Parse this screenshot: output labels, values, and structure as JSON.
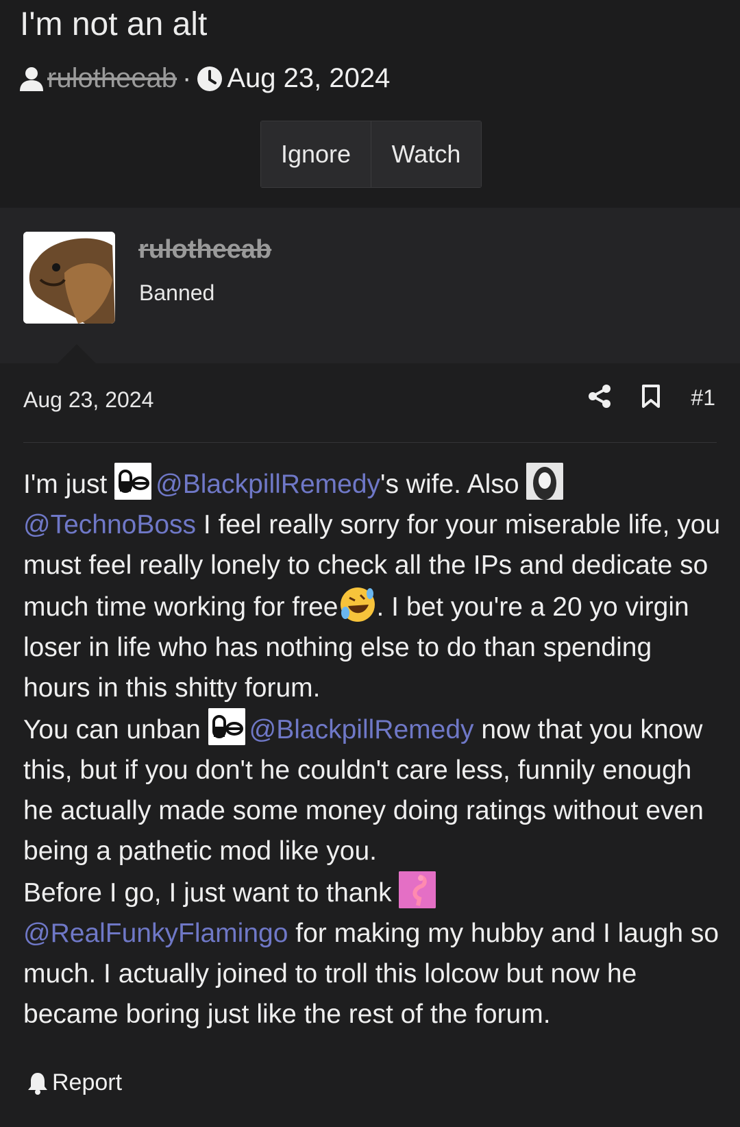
{
  "thread": {
    "title": "I'm not an alt",
    "author": "rulotheeab",
    "date": "Aug 23, 2024"
  },
  "buttons": {
    "ignore": "Ignore",
    "watch": "Watch"
  },
  "user": {
    "name": "rulotheeab",
    "title": "Banned"
  },
  "post": {
    "date": "Aug 23, 2024",
    "number": "#1",
    "body": {
      "t1": "I'm just ",
      "m1": "@BlackpillRemedy",
      "t2": "'s wife. Also ",
      "m2": "@TechnoBoss",
      "t3": " I feel really sorry for your miserable life, you must feel really lonely to check all the IPs and dedicate so much time working for free",
      "t4": ". I bet you're a 20 yo virgin loser in life who has nothing else to do than spending hours in this shitty forum.",
      "t5": "You can unban ",
      "m3": "@BlackpillRemedy",
      "t6": " now that you know this, but if you don't he couldn't care less, funnily enough he actually made some money doing ratings without even being a pathetic mod like you.",
      "t7": "Before I go, I just want to thank ",
      "m4": "@RealFunkyFlamingo",
      "t8": " for making my hubby and I laugh so much. I actually joined to troll this lolcow but now he became boring just like the rest of the forum."
    },
    "report_label": "Report"
  },
  "colors": {
    "mention": "#6f78c7",
    "background": "#1e1e1f",
    "user_block": "#242426"
  },
  "icons": [
    "user-icon",
    "clock-icon",
    "share-icon",
    "bookmark-icon",
    "bell-icon",
    "rofl-emoji"
  ]
}
